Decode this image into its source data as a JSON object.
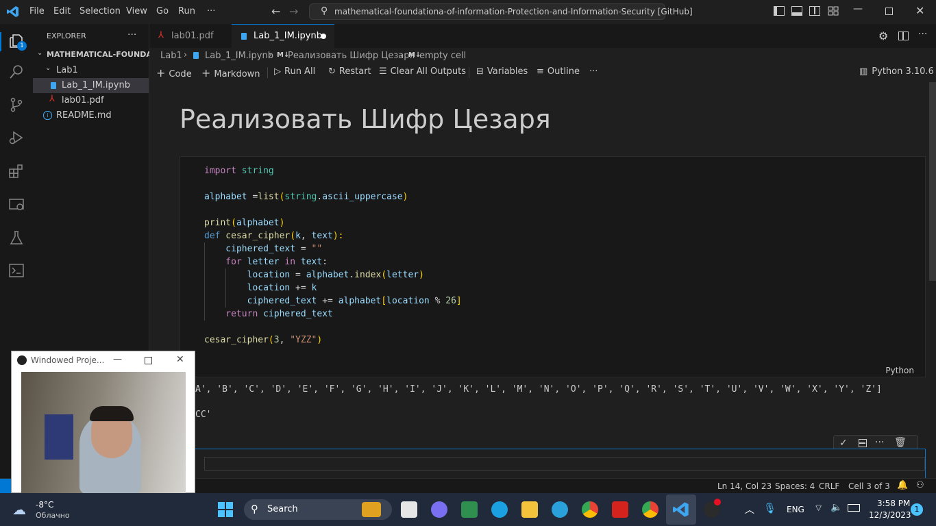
{
  "menu": {
    "file": "File",
    "edit": "Edit",
    "selection": "Selection",
    "view": "View",
    "go": "Go",
    "run": "Run",
    "more": "···"
  },
  "command_center": "mathematical-foundationa-of-information-Protection-and-Information-Security [GitHub]",
  "activity": {
    "explorer_badge": "1"
  },
  "sidebar": {
    "title": "EXPLORER",
    "more": "···",
    "root": "MATHEMATICAL-FOUNDA...",
    "items": [
      {
        "label": "Lab1"
      },
      {
        "label": "Lab_1_IM.ipynb"
      },
      {
        "label": "lab01.pdf"
      },
      {
        "label": "README.md"
      }
    ]
  },
  "tabs": [
    {
      "label": "lab01.pdf"
    },
    {
      "label": "Lab_1_IM.ipynb"
    }
  ],
  "breadcrumb": {
    "p1": "Lab1",
    "p2": "Lab_1_IM.ipynb",
    "p3_prefix": "M↓",
    "p3": "Реализовать Шифр Цезаря",
    "p4_prefix": "M↓",
    "p4": "empty cell"
  },
  "toolbar": {
    "code": "Code",
    "markdown": "Markdown",
    "run_all": "Run All",
    "restart": "Restart",
    "clear": "Clear All Outputs",
    "variables": "Variables",
    "outline": "Outline",
    "more": "···",
    "kernel": "Python 3.10.6"
  },
  "notebook": {
    "md_title": "Реализовать Шифр Цезаря",
    "code": {
      "l1a": "import",
      "l1b": " string",
      "l2a": "alphabet",
      "l2b": " =",
      "l2c": "list",
      "l2d": "(",
      "l2e": "string",
      "l2f": ".",
      "l2g": "ascii_uppercase",
      "l2h": ")",
      "l3a": "print",
      "l3b": "(",
      "l3c": "alphabet",
      "l3d": ")",
      "l4a": "def",
      "l4b": " cesar_cipher",
      "l4c": "(",
      "l4d": "k",
      "l4e": ", ",
      "l4f": "text",
      "l4g": "):",
      "l5a": "    ciphered_text",
      "l5b": " = ",
      "l5c": "\"\"",
      "l6a": "    for",
      "l6b": " letter",
      "l6c": " in",
      "l6d": " text",
      "l6e": ":",
      "l7a": "        location",
      "l7b": " = ",
      "l7c": "alphabet",
      "l7d": ".",
      "l7e": "index",
      "l7f": "(",
      "l7g": "letter",
      "l7h": ")",
      "l8a": "        location",
      "l8b": " += ",
      "l8c": "k",
      "l9a": "        ciphered_text",
      "l9b": " += ",
      "l9c": "alphabet",
      "l9d": "[",
      "l9e": "location",
      "l9f": " % ",
      "l9g": "26",
      "l9h": "]",
      "l10a": "    return",
      "l10b": " ciphered_text",
      "l11a": "cesar_cipher",
      "l11b": "(",
      "l11c": "3",
      "l11d": ", ",
      "l11e": "\"YZZ\"",
      "l11f": ")"
    },
    "lang": "Python",
    "output1": "A', 'B', 'C', 'D', 'E', 'F', 'G', 'H', 'I', 'J', 'K', 'L', 'M', 'N', 'O', 'P', 'Q', 'R', 'S', 'T', 'U', 'V', 'W', 'X', 'Y', 'Z']",
    "output2": "CC'"
  },
  "status": {
    "pos": "Ln 14, Col 23",
    "spaces": "Spaces: 4",
    "eol": "CRLF",
    "cell": "Cell 3 of 3"
  },
  "webcam": {
    "title": "Windowed Proje..."
  },
  "taskbar": {
    "temp": "-8°C",
    "weather": "Облачно",
    "search": "Search",
    "lang": "ENG",
    "time": "3:58 PM",
    "date": "12/3/2023",
    "notif": "1"
  },
  "colors": {
    "accent": "#0078d4",
    "bg": "#1f1f1f",
    "sidebar": "#181818",
    "taskbar": "#202a3a"
  }
}
